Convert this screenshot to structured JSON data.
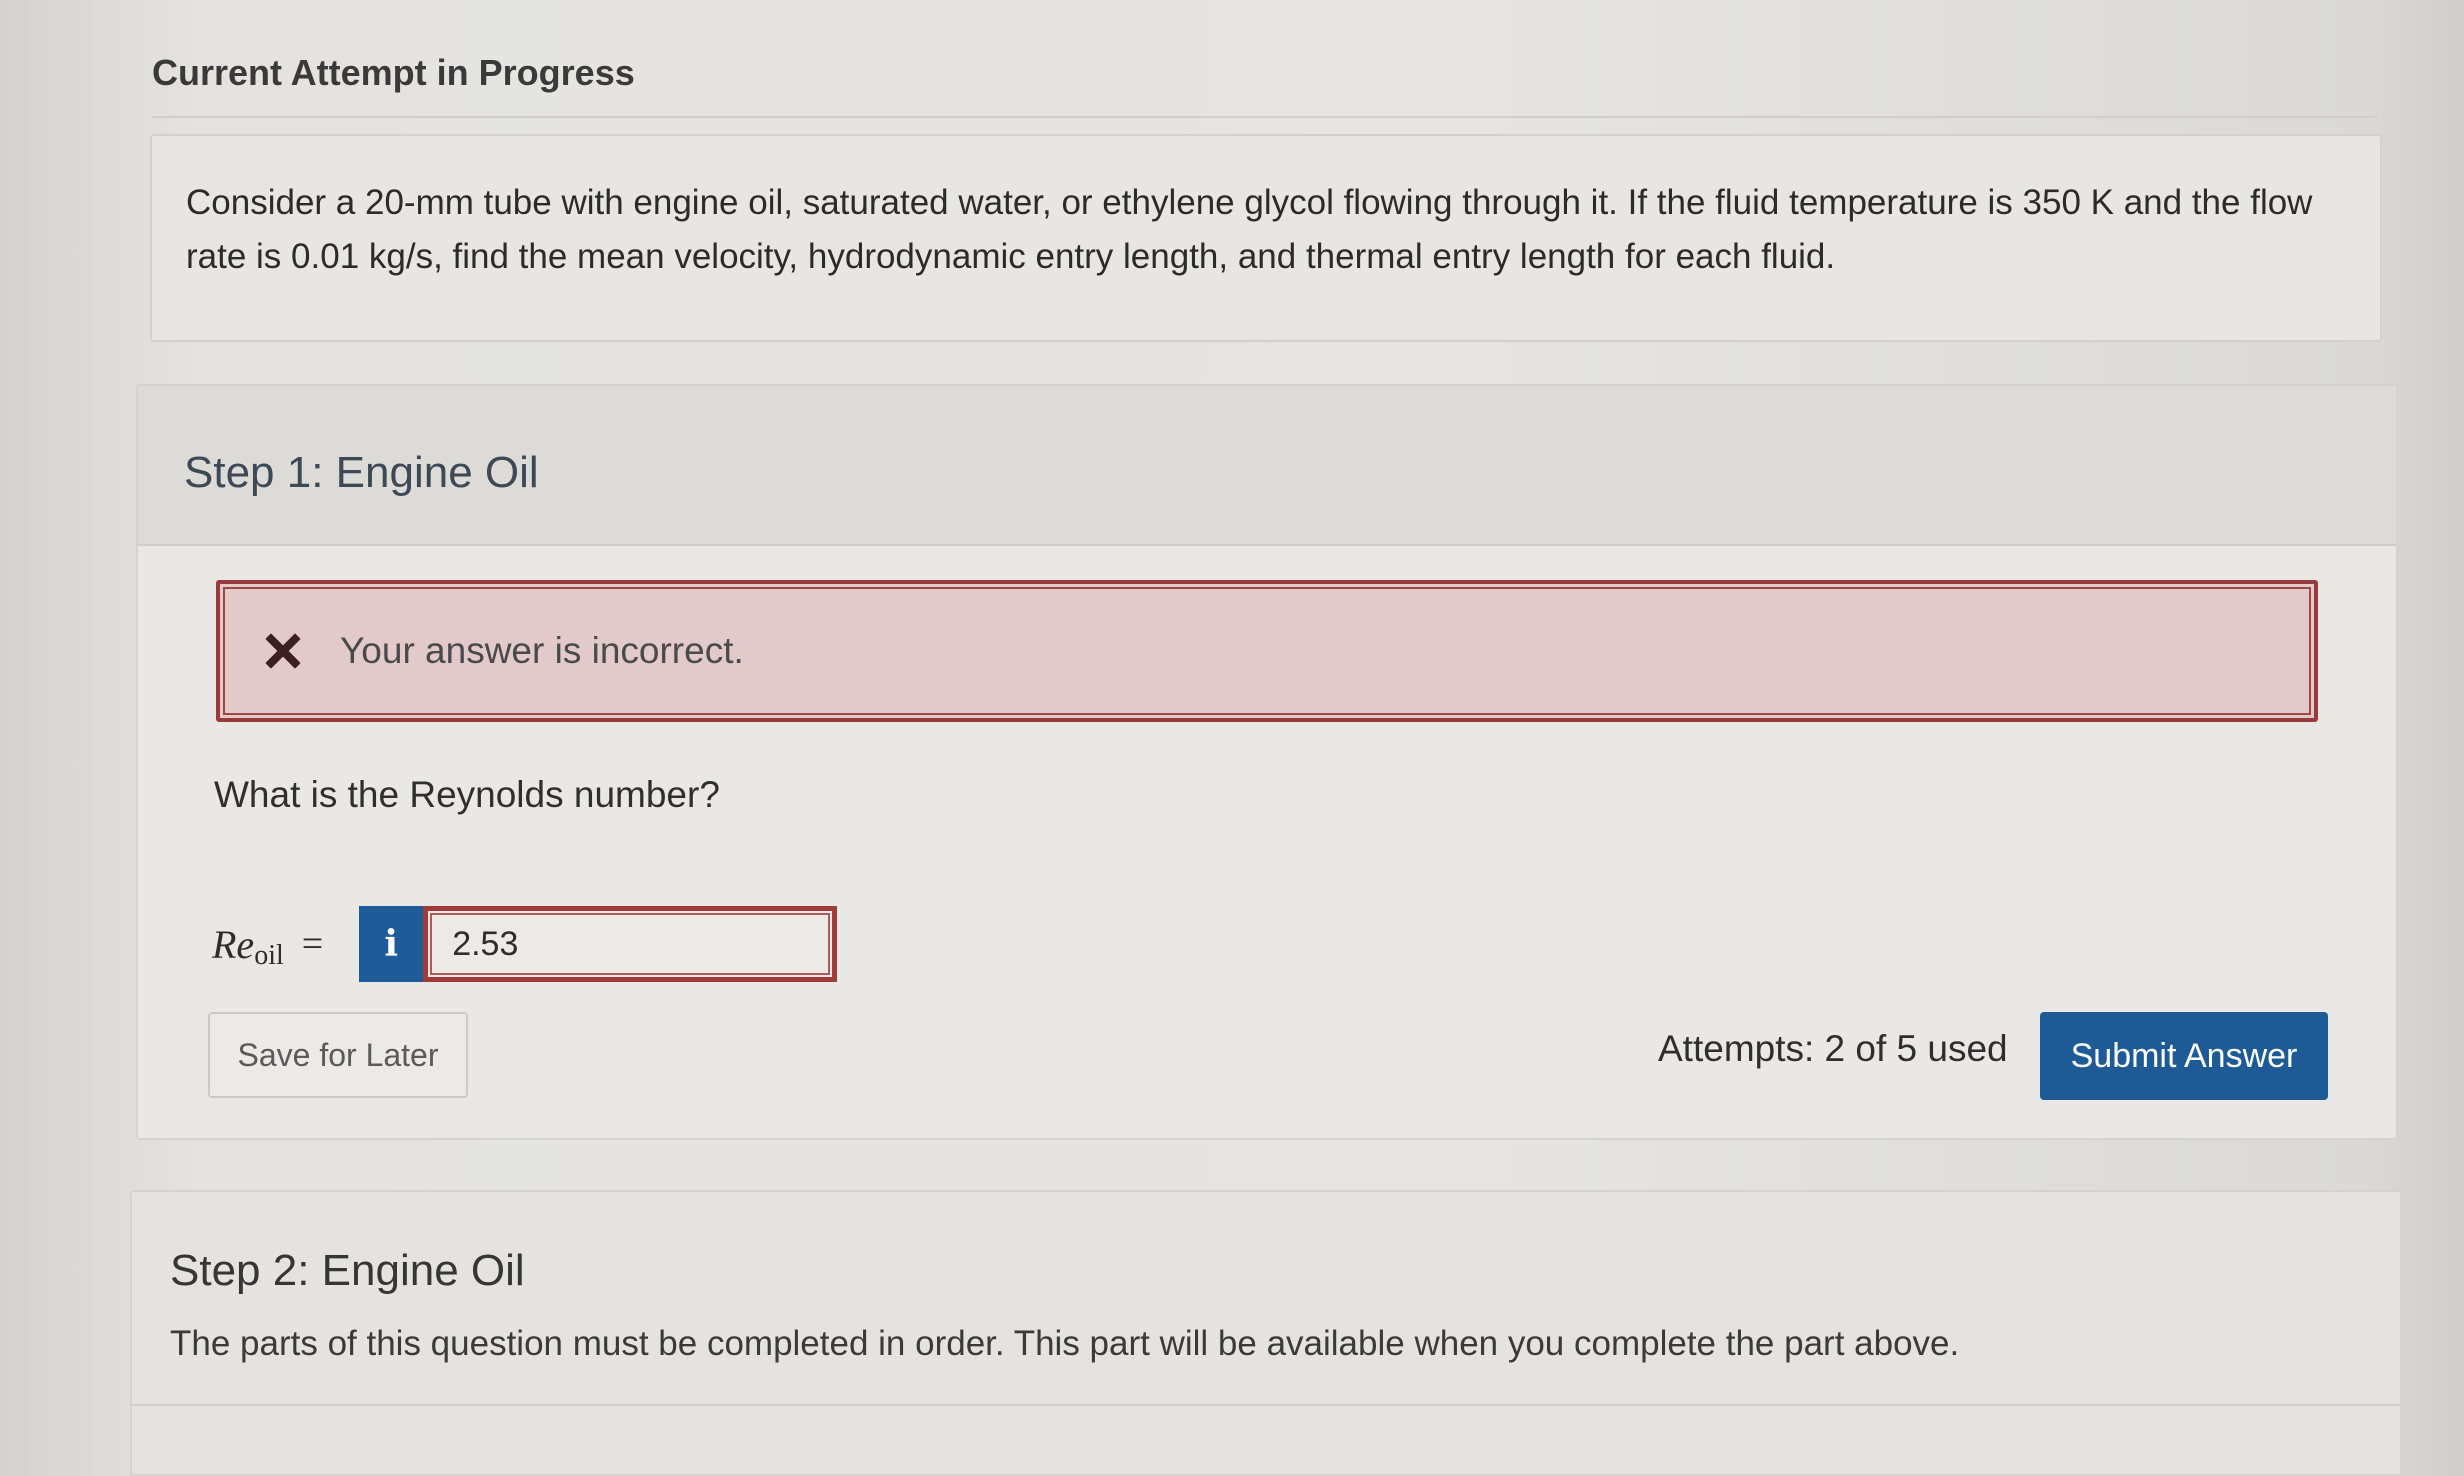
{
  "header": {
    "title": "Current Attempt in Progress"
  },
  "question": {
    "text": "Consider a 20-mm tube with engine oil, saturated water, or ethylene glycol flowing through it. If the fluid temperature is 350 K and the flow rate is 0.01 kg/s, find the mean velocity, hydrodynamic entry length, and thermal entry length for each fluid."
  },
  "step1": {
    "title": "Step 1: Engine Oil",
    "feedback": {
      "icon": "x-icon",
      "text": "Your answer is incorrect."
    },
    "prompt": "What is the Reynolds number?",
    "equation": {
      "symbol": "Re",
      "subscript": "oil",
      "equals": "=",
      "info_label": "i",
      "value": "2.53"
    },
    "save_label": "Save for Later",
    "attempts_text": "Attempts: 2 of 5 used",
    "submit_label": "Submit Answer",
    "colors": {
      "submit": "#1e5b96",
      "error_border": "#9b3a3a",
      "error_bg": "#e3caca"
    }
  },
  "step2": {
    "title": "Step 2: Engine Oil",
    "text": "The parts of this question must be completed in order. This part will be available when you complete the part above."
  }
}
